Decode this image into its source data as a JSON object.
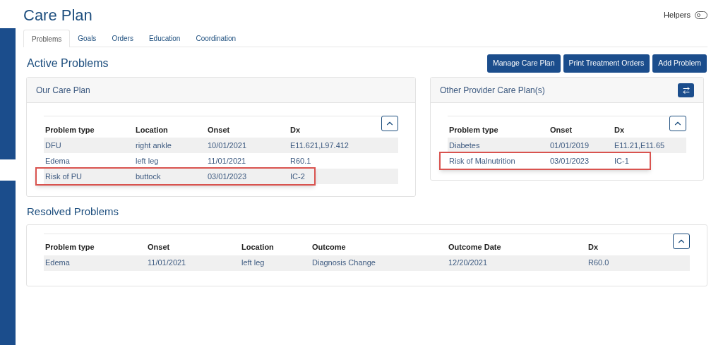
{
  "page": {
    "title": "Care Plan",
    "helpers": {
      "label": "Helpers",
      "on": false
    }
  },
  "tabs": [
    {
      "label": "Problems",
      "selected": true
    },
    {
      "label": "Goals",
      "selected": false
    },
    {
      "label": "Orders",
      "selected": false
    },
    {
      "label": "Education",
      "selected": false
    },
    {
      "label": "Coordination",
      "selected": false
    }
  ],
  "active_problems": {
    "title": "Active Problems",
    "buttons": [
      "Manage Care Plan",
      "Print Treatment Orders",
      "Add Problem"
    ],
    "our_care_plan": {
      "title": "Our Care Plan",
      "columns": [
        "Problem type",
        "Location",
        "Onset",
        "Dx"
      ],
      "rows": [
        {
          "cells": [
            "DFU",
            "right ankle",
            "10/01/2021",
            "E11.621,L97.412"
          ],
          "highlighted": false
        },
        {
          "cells": [
            "Edema",
            "left leg",
            "11/01/2021",
            "R60.1"
          ],
          "highlighted": false
        },
        {
          "cells": [
            "Risk of PU",
            "buttock",
            "03/01/2023",
            "IC-2"
          ],
          "highlighted": true
        }
      ]
    },
    "other_provider": {
      "title": "Other Provider Care Plan(s)",
      "columns": [
        "Problem type",
        "Onset",
        "Dx"
      ],
      "rows": [
        {
          "cells": [
            "Diabetes",
            "01/01/2019",
            "E11.21,E11.65"
          ],
          "highlighted": false
        },
        {
          "cells": [
            "Risk of Malnutrition",
            "03/01/2023",
            "IC-1"
          ],
          "highlighted": true
        }
      ]
    }
  },
  "resolved_problems": {
    "title": "Resolved Problems",
    "columns": [
      "Problem type",
      "Onset",
      "Location",
      "Outcome",
      "Outcome Date",
      "Dx"
    ],
    "rows": [
      {
        "cells": [
          "Edema",
          "11/01/2021",
          "left leg",
          "Diagnosis Change",
          "12/20/2021",
          "R60.0"
        ],
        "highlighted": false
      }
    ]
  }
}
